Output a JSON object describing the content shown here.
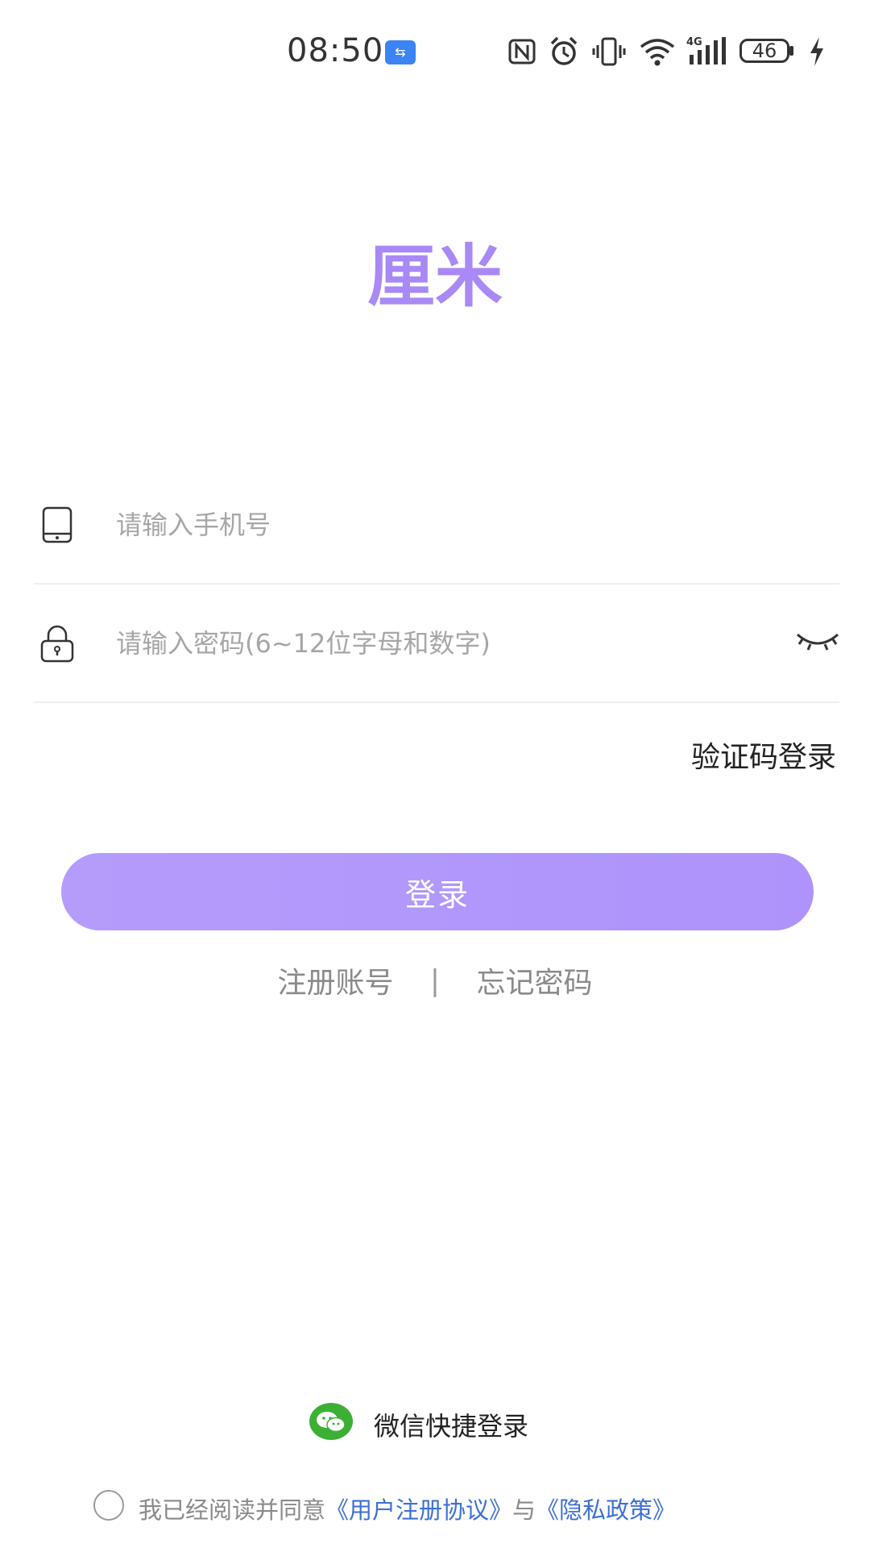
{
  "status_bar": {
    "time": "08:50",
    "battery": "46",
    "icons": [
      "usb-icon",
      "nfc-icon",
      "alarm-icon",
      "vibrate-icon",
      "wifi-icon",
      "signal-4g-icon",
      "battery-icon",
      "charging-icon"
    ]
  },
  "logo": {
    "text": "厘米",
    "color": "#a889f5"
  },
  "phone": {
    "placeholder": "请输入手机号"
  },
  "password": {
    "placeholder": "请输入密码(6~12位字母和数字)"
  },
  "sms_login_label": "验证码登录",
  "login_button_label": "登录",
  "links": {
    "register": "注册账号",
    "separator": "|",
    "forgot": "忘记密码"
  },
  "wechat_login_label": "微信快捷登录",
  "agreement": {
    "prefix": "我已经阅读并同意",
    "terms_link": "《用户注册协议》",
    "and": "与",
    "privacy_link": "《隐私政策》"
  },
  "colors": {
    "accent": "#ad93fb",
    "link": "#3d6fd6",
    "wechat": "#3cb035"
  }
}
